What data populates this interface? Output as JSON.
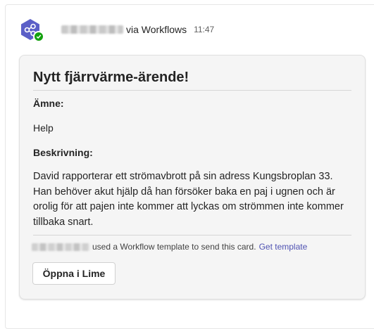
{
  "message": {
    "via_text": "via Workflows",
    "time": "11:47",
    "avatar_icon": "share-nodes-icon",
    "status_icon": "check-icon",
    "colors": {
      "avatar": "#5b5fc7",
      "status": "#13a10e",
      "link": "#4f52b2"
    }
  },
  "card": {
    "title": "Nytt fjärrvärme-ärende!",
    "subject_label": "Ämne:",
    "subject_value": "Help",
    "description_label": "Beskrivning:",
    "description_value": "David rapporterar ett strömavbrott på sin adress Kungsbroplan 33. Han behöver akut hjälp då han försöker baka en paj i ugnen och är orolig för att pajen inte kommer att lyckas om strömmen inte kommer tillbaka snart.",
    "footer_text": "used a Workflow template to send this card.",
    "footer_link": "Get template",
    "action_button": "Öppna i Lime"
  }
}
